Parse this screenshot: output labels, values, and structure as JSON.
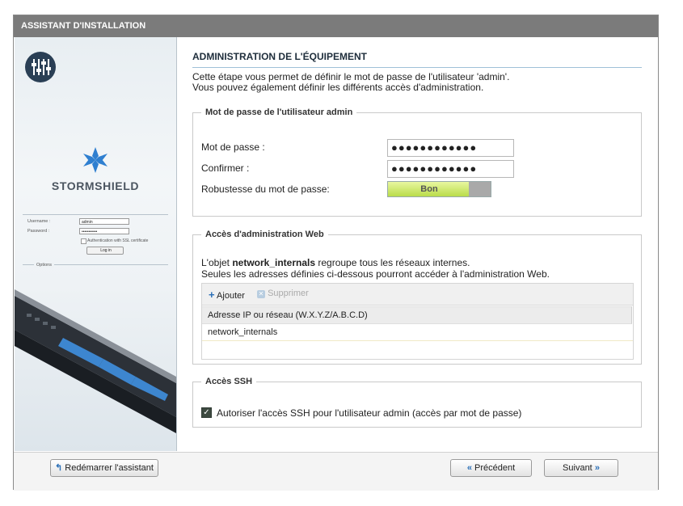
{
  "window": {
    "title": "ASSISTANT D'INSTALLATION"
  },
  "sidebar": {
    "brand": "STORMSHIELD",
    "login": {
      "username_label": "Username :",
      "username_value": "admin",
      "password_label": "Password :",
      "password_value": "•••••••••••",
      "ssl_label": "Authentication with SSL certificate",
      "login_button": "Log in",
      "options_label": "Options"
    }
  },
  "section": {
    "title": "ADMINISTRATION DE L'ÉQUIPEMENT",
    "intro_line1": "Cette étape vous permet de définir le mot de passe de l'utilisateur 'admin'.",
    "intro_line2": "Vous pouvez également définir les différents accès d'administration."
  },
  "password_box": {
    "legend": "Mot de passe de l'utilisateur admin",
    "password_label": "Mot de passe :",
    "password_value": "●●●●●●●●●●●●",
    "confirm_label": "Confirmer :",
    "confirm_value": "●●●●●●●●●●●●",
    "strength_label": "Robustesse du mot de passe:",
    "strength_value": "Bon",
    "strength_fraction": 0.79
  },
  "web_box": {
    "legend": "Accès d'administration Web",
    "text_prefix": "L'objet ",
    "text_object": "network_internals",
    "text_suffix": " regroupe tous les réseaux internes.",
    "text_line2": "Seules les adresses définies ci-dessous pourront accéder à l'administration Web.",
    "add_label": "Ajouter",
    "remove_label": "Supprimer",
    "column_header": "Adresse IP ou réseau (W.X.Y.Z/A.B.C.D)",
    "rows": [
      "network_internals"
    ]
  },
  "ssh_box": {
    "legend": "Accès SSH",
    "checkbox_label": "Autoriser l'accès SSH pour l'utilisateur admin (accès par mot de passe)",
    "checked": true
  },
  "footer": {
    "restart_label": "Redémarrer l'assistant",
    "previous_label": "Précédent",
    "next_label": "Suivant"
  },
  "colors": {
    "titlebar": "#7b7b7b",
    "accent_blue": "#2a6fb7",
    "strength_green": "#b9dc4a"
  }
}
